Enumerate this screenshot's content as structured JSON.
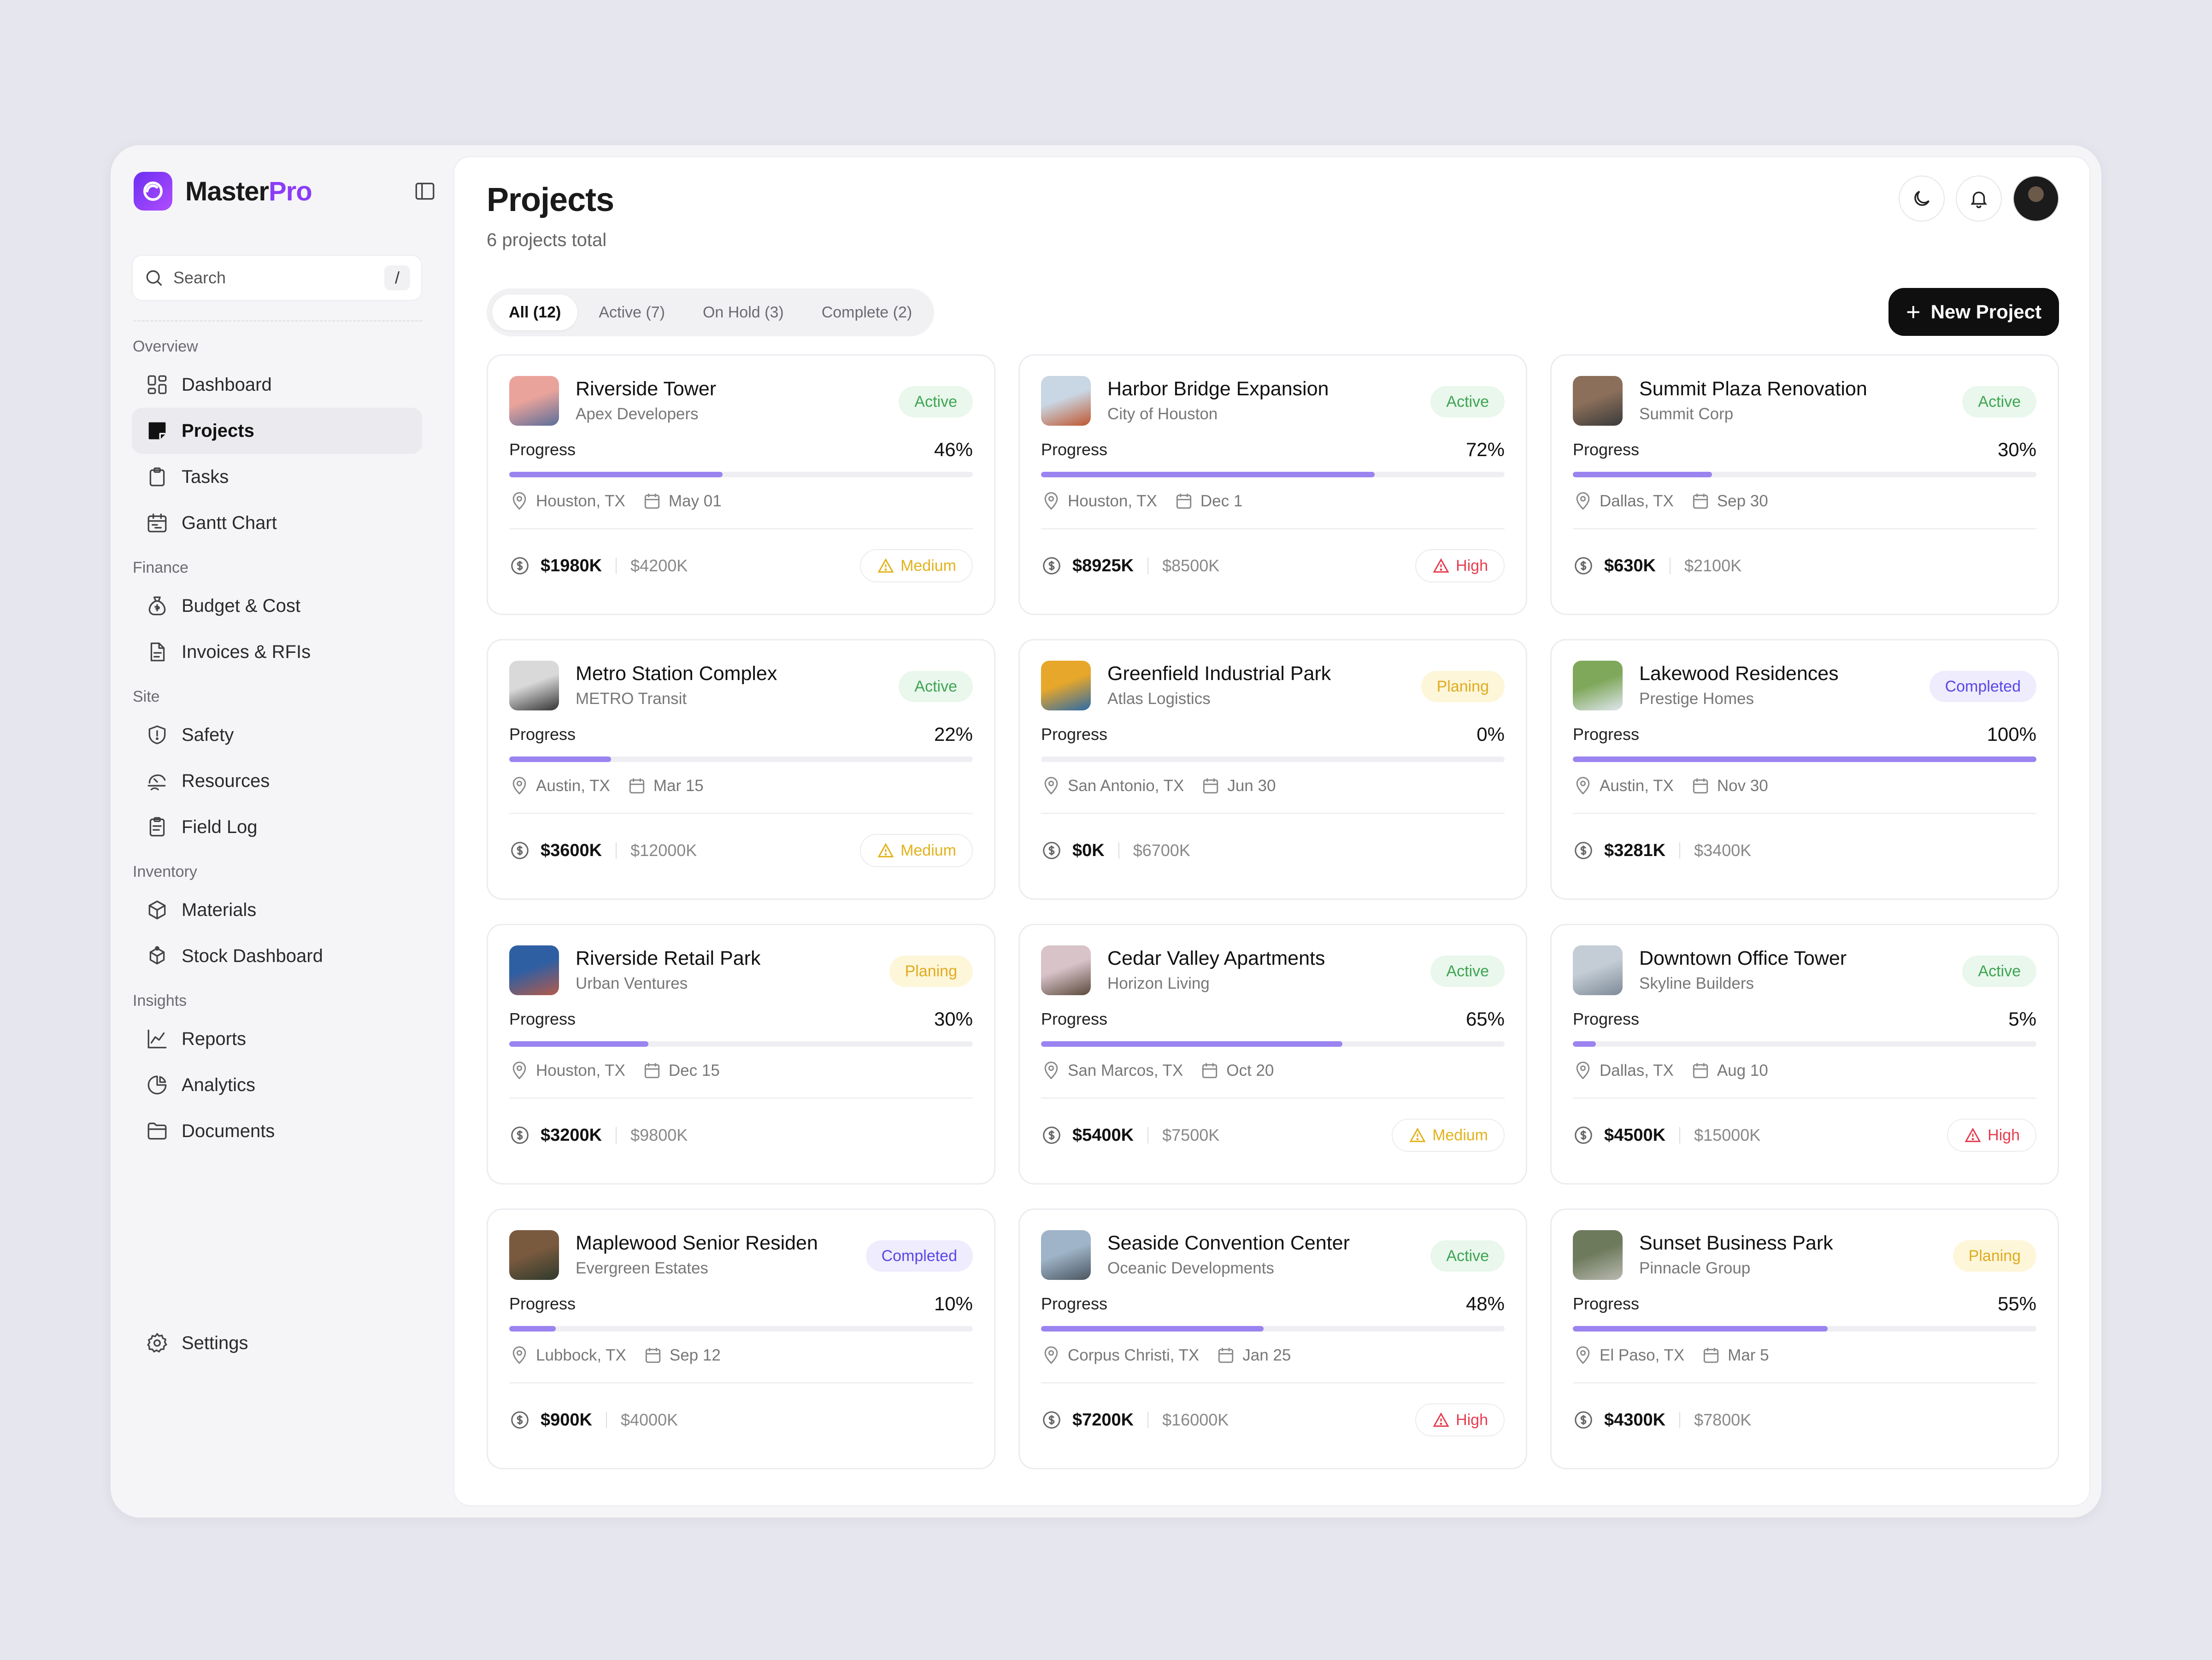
{
  "brand": {
    "name_main": "Master",
    "name_accent": "Pro",
    "accent_color": "#8b3cf7"
  },
  "search": {
    "placeholder": "Search",
    "shortcut": "/"
  },
  "sidebar": {
    "sections": [
      {
        "label": "Overview",
        "items": [
          {
            "label": "Dashboard",
            "icon": "dashboard-icon"
          },
          {
            "label": "Projects",
            "icon": "projects-icon",
            "active": true
          },
          {
            "label": "Tasks",
            "icon": "tasks-icon"
          },
          {
            "label": "Gantt Chart",
            "icon": "calendar-icon"
          }
        ]
      },
      {
        "label": "Finance",
        "items": [
          {
            "label": "Budget & Cost",
            "icon": "money-bag-icon"
          },
          {
            "label": "Invoices & RFIs",
            "icon": "document-icon"
          }
        ]
      },
      {
        "label": "Site",
        "items": [
          {
            "label": "Safety",
            "icon": "shield-icon"
          },
          {
            "label": "Resources",
            "icon": "resources-icon"
          },
          {
            "label": "Field Log",
            "icon": "clipboard-icon"
          }
        ]
      },
      {
        "label": "Inventory",
        "items": [
          {
            "label": "Materials",
            "icon": "box-icon"
          },
          {
            "label": "Stock Dashboard",
            "icon": "stock-icon"
          }
        ]
      },
      {
        "label": "Insights",
        "items": [
          {
            "label": "Reports",
            "icon": "chart-line-icon"
          },
          {
            "label": "Analytics",
            "icon": "pie-icon"
          },
          {
            "label": "Documents",
            "icon": "folder-icon"
          }
        ]
      }
    ],
    "settings_label": "Settings"
  },
  "header": {
    "title": "Projects",
    "subtitle": "6 projects total"
  },
  "tabs": [
    {
      "label": "All (12)",
      "active": true
    },
    {
      "label": "Active (7)"
    },
    {
      "label": "On Hold (3)"
    },
    {
      "label": "Complete (2)"
    }
  ],
  "new_project_label": "New Project",
  "progress_label": "Progress",
  "projects": [
    {
      "name": "Riverside Tower",
      "client": "Apex Developers",
      "status": "Active",
      "progress": 46,
      "progress_text": "46%",
      "location": "Houston, TX",
      "date": "May 01",
      "spent": "$1980K",
      "budget": "$4200K",
      "priority": "Medium",
      "thumb": [
        "#e9a39b",
        "#5a6d9a"
      ]
    },
    {
      "name": "Harbor Bridge Expansion",
      "client": "City of Houston",
      "status": "Active",
      "progress": 72,
      "progress_text": "72%",
      "location": "Houston, TX",
      "date": "Dec 1",
      "spent": "$8925K",
      "budget": "$8500K",
      "priority": "High",
      "thumb": [
        "#c9d6e3",
        "#c0562f"
      ]
    },
    {
      "name": "Summit Plaza Renovation",
      "client": "Summit Corp",
      "status": "Active",
      "progress": 30,
      "progress_text": "30%",
      "location": "Dallas, TX",
      "date": "Sep 30",
      "spent": "$630K",
      "budget": "$2100K",
      "priority": "",
      "thumb": [
        "#8b6f5a",
        "#3a3a3a"
      ]
    },
    {
      "name": "Metro Station Complex",
      "client": "METRO Transit",
      "status": "Active",
      "progress": 22,
      "progress_text": "22%",
      "location": "Austin, TX",
      "date": "Mar 15",
      "spent": "$3600K",
      "budget": "$12000K",
      "priority": "Medium",
      "thumb": [
        "#d9d9d9",
        "#333333"
      ]
    },
    {
      "name": "Greenfield Industrial Park",
      "client": "Atlas Logistics",
      "status": "Planing",
      "progress": 0,
      "progress_text": "0%",
      "location": "San Antonio, TX",
      "date": "Jun 30",
      "spent": "$0K",
      "budget": "$6700K",
      "priority": "",
      "thumb": [
        "#e6a72a",
        "#2b6aa8"
      ]
    },
    {
      "name": "Lakewood Residences",
      "client": "Prestige Homes",
      "status": "Completed",
      "progress": 100,
      "progress_text": "100%",
      "location": "Austin, TX",
      "date": "Nov 30",
      "spent": "$3281K",
      "budget": "$3400K",
      "priority": "",
      "thumb": [
        "#7fa85a",
        "#dfe6ee"
      ]
    },
    {
      "name": "Riverside Retail Park",
      "client": "Urban Ventures",
      "status": "Planing",
      "progress": 30,
      "progress_text": "30%",
      "location": "Houston, TX",
      "date": "Dec 15",
      "spent": "$3200K",
      "budget": "$9800K",
      "priority": "",
      "thumb": [
        "#2f5fa3",
        "#b45a4a"
      ]
    },
    {
      "name": "Cedar Valley Apartments",
      "client": "Horizon Living",
      "status": "Active",
      "progress": 65,
      "progress_text": "65%",
      "location": "San Marcos, TX",
      "date": "Oct 20",
      "spent": "$5400K",
      "budget": "$7500K",
      "priority": "Medium",
      "thumb": [
        "#d8c3c9",
        "#5b4a3c"
      ]
    },
    {
      "name": "Downtown Office Tower",
      "client": "Skyline Builders",
      "status": "Active",
      "progress": 5,
      "progress_text": "5%",
      "location": "Dallas, TX",
      "date": "Aug 10",
      "spent": "$4500K",
      "budget": "$15000K",
      "priority": "High",
      "thumb": [
        "#c4cdd6",
        "#7d8a96"
      ]
    },
    {
      "name": "Maplewood Senior Residen",
      "client": "Evergreen Estates",
      "status": "Completed",
      "progress": 10,
      "progress_text": "10%",
      "location": "Lubbock, TX",
      "date": "Sep 12",
      "spent": "$900K",
      "budget": "$4000K",
      "priority": "",
      "thumb": [
        "#7a5a3f",
        "#2f3a2c"
      ]
    },
    {
      "name": "Seaside Convention Center",
      "client": "Oceanic Developments",
      "status": "Active",
      "progress": 48,
      "progress_text": "48%",
      "location": "Corpus Christi, TX",
      "date": "Jan 25",
      "spent": "$7200K",
      "budget": "$16000K",
      "priority": "High",
      "thumb": [
        "#9fb4c8",
        "#4a5560"
      ]
    },
    {
      "name": "Sunset Business Park",
      "client": "Pinnacle Group",
      "status": "Planing",
      "progress": 55,
      "progress_text": "55%",
      "location": "El Paso, TX",
      "date": "Mar 5",
      "spent": "$4300K",
      "budget": "$7800K",
      "priority": "",
      "thumb": [
        "#6d7a5c",
        "#b9b9b0"
      ]
    }
  ]
}
